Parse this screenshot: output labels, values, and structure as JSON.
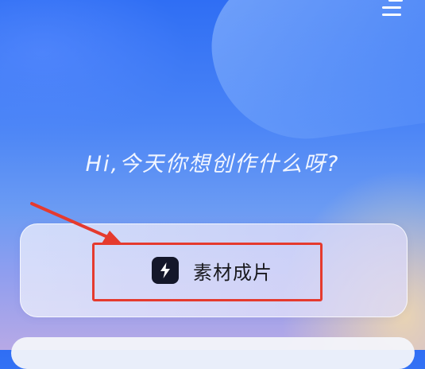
{
  "greeting": "Hi,今天你想创作什么呀?",
  "action_card": {
    "icon": "lightning-icon",
    "label": "素材成片"
  },
  "menu": {
    "icon": "menu-icon"
  },
  "colors": {
    "annotation_red": "#e53a2e",
    "icon_tile": "#14172a"
  }
}
